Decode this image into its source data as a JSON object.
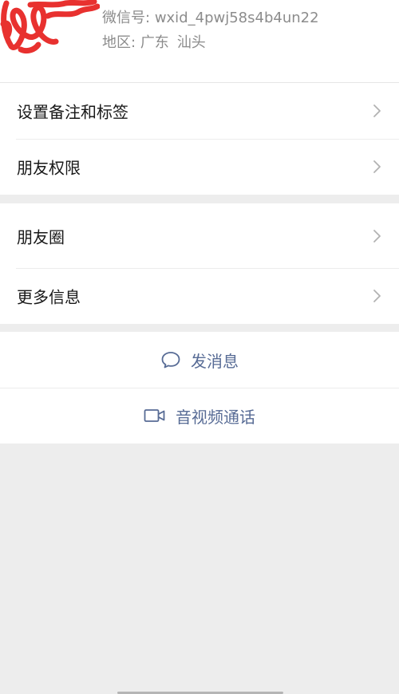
{
  "profile": {
    "wechat_id_label": "微信号:",
    "wechat_id": "wxid_4pwj58s4b4un22",
    "region_label": "地区:",
    "region_province": "广东",
    "region_city": "汕头"
  },
  "settings_group": {
    "items": [
      {
        "label": "设置备注和标签",
        "icon": "chevron-right-icon"
      },
      {
        "label": "朋友权限",
        "icon": "chevron-right-icon"
      }
    ]
  },
  "info_group": {
    "items": [
      {
        "label": "朋友圈",
        "icon": "chevron-right-icon"
      },
      {
        "label": "更多信息",
        "icon": "chevron-right-icon"
      }
    ]
  },
  "actions": {
    "send_message": {
      "label": "发消息",
      "icon": "chat-bubble-icon"
    },
    "video_call": {
      "label": "音视频通话",
      "icon": "video-camera-icon"
    }
  },
  "colors": {
    "link": "#576b95",
    "scribble": "#e8312f",
    "background": "#ededed"
  }
}
